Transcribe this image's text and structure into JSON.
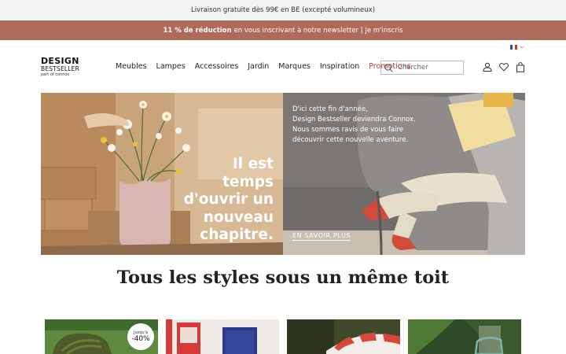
{
  "topbar": {
    "shipping_text": "Livraison gratuite dès 99€ en BE (excepté volumineux)"
  },
  "promobar": {
    "bold": "11 % de réduction",
    "rest": "en vous inscrivant à notre newsletter | Je m'inscris"
  },
  "language": {
    "flag": "fr-flag-icon"
  },
  "logo": {
    "line1": "DESIGN",
    "line2": "BESTSELLER",
    "line3": "part of connox"
  },
  "nav": {
    "items": [
      "Meubles",
      "Lampes",
      "Accessoires",
      "Jardin",
      "Marques",
      "Inspiration",
      "Promotions"
    ]
  },
  "search": {
    "placeholder": "Chercher"
  },
  "hero": {
    "title_lines": [
      "Il est",
      "temps",
      "d'ouvrir un",
      "nouveau",
      "chapitre."
    ],
    "copy_lines": [
      "D'ici cette fin d'année,",
      "Design Bestseller deviendra Connox.",
      "Nous sommes ravis de vous faire",
      "découvrir cette nouvelle aventure."
    ],
    "cta": "EN SAVOIR PLUS"
  },
  "section": {
    "title": "Tous les styles sous un même toit"
  },
  "cards": [
    {
      "badge_top": "Jusqu'à",
      "badge_value": "-40%"
    },
    {},
    {},
    {}
  ],
  "colors": {
    "promo_bar": "#b06a5a",
    "promotions_link": "#b0413e"
  }
}
